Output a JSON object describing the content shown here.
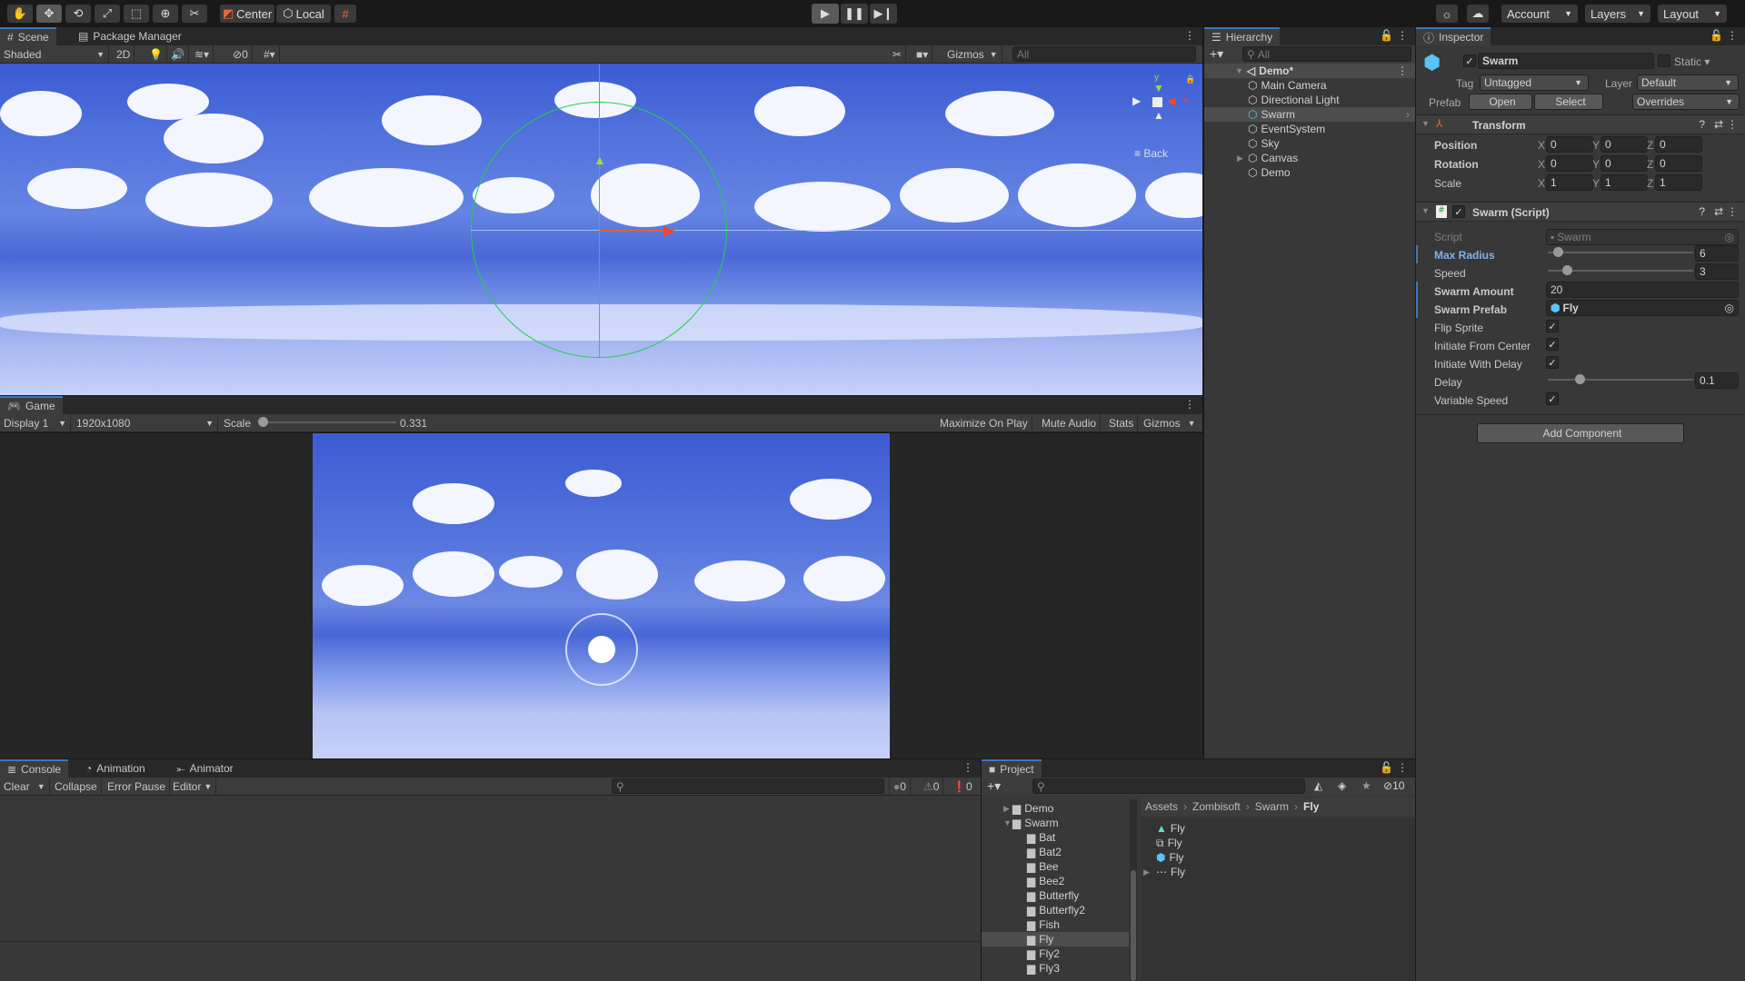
{
  "toolbar": {
    "tools": [
      "hand-tool",
      "move-tool",
      "rotate-tool",
      "scale-tool",
      "rect-tool",
      "transform-tool",
      "custom-tool"
    ],
    "pivot_mode": "Center",
    "pivot_rotation": "Local",
    "account": "Account",
    "layers": "Layers",
    "layout": "Layout"
  },
  "scene": {
    "tabs": [
      {
        "label": "Scene"
      },
      {
        "label": "Package Manager"
      }
    ],
    "shading": "Shaded",
    "mode_2d": "2D",
    "hidden_count": "0",
    "gizmos": "Gizmos",
    "search_placeholder": "All",
    "back_label": "Back",
    "axis_x": "x",
    "axis_y": "y"
  },
  "game": {
    "tab": "Game",
    "display": "Display 1",
    "resolution": "1920x1080",
    "scale_label": "Scale",
    "scale_value": "0.331",
    "scale_fraction": 0.02,
    "maximize": "Maximize On Play",
    "mute": "Mute Audio",
    "stats": "Stats",
    "gizmos": "Gizmos"
  },
  "console": {
    "tabs": [
      {
        "label": "Console"
      },
      {
        "label": "Animation"
      },
      {
        "label": "Animator"
      }
    ],
    "clear": "Clear",
    "collapse": "Collapse",
    "error_pause": "Error Pause",
    "editor": "Editor",
    "log_count": "0",
    "warn_count": "0",
    "error_count": "0"
  },
  "hierarchy": {
    "title": "Hierarchy",
    "search_placeholder": "All",
    "scene": "Demo*",
    "items": [
      {
        "label": "Main Camera"
      },
      {
        "label": "Directional Light"
      },
      {
        "label": "Swarm",
        "selected": true
      },
      {
        "label": "EventSystem"
      },
      {
        "label": "Sky"
      },
      {
        "label": "Canvas",
        "expandable": true
      },
      {
        "label": "Demo"
      }
    ]
  },
  "inspector": {
    "title": "Inspector",
    "object_name": "Swarm",
    "static_label": "Static",
    "tag_label": "Tag",
    "tag": "Untagged",
    "layer_label": "Layer",
    "layer": "Default",
    "prefab_label": "Prefab",
    "open": "Open",
    "select": "Select",
    "overrides": "Overrides",
    "transform": {
      "title": "Transform",
      "rows": [
        {
          "label": "Position",
          "x": "0",
          "y": "0",
          "z": "0"
        },
        {
          "label": "Rotation",
          "x": "0",
          "y": "0",
          "z": "0"
        },
        {
          "label": "Scale",
          "x": "1",
          "y": "1",
          "z": "1"
        }
      ]
    },
    "script": {
      "title": "Swarm (Script)",
      "script_label": "Script",
      "script_value": "Swarm",
      "max_radius_label": "Max Radius",
      "max_radius": "6",
      "max_radius_fraction": 0.07,
      "speed_label": "Speed",
      "speed": "3",
      "speed_fraction": 0.13,
      "swarm_amount_label": "Swarm Amount",
      "swarm_amount": "20",
      "swarm_prefab_label": "Swarm Prefab",
      "swarm_prefab": "Fly",
      "flip_sprite_label": "Flip Sprite",
      "initiate_center_label": "Initiate From Center",
      "initiate_delay_label": "Initiate With Delay",
      "delay_label": "Delay",
      "delay": "0.1",
      "delay_fraction": 0.22,
      "variable_speed_label": "Variable Speed"
    },
    "add_component": "Add Component"
  },
  "project": {
    "title": "Project",
    "hidden_count": "10",
    "tree": [
      {
        "label": "Demo",
        "indent": 1,
        "arrow": "right"
      },
      {
        "label": "Swarm",
        "indent": 1,
        "arrow": "down"
      },
      {
        "label": "Bat",
        "indent": 2
      },
      {
        "label": "Bat2",
        "indent": 2
      },
      {
        "label": "Bee",
        "indent": 2
      },
      {
        "label": "Bee2",
        "indent": 2
      },
      {
        "label": "Butterfly",
        "indent": 2
      },
      {
        "label": "Butterfly2",
        "indent": 2
      },
      {
        "label": "Fish",
        "indent": 2
      },
      {
        "label": "Fly",
        "indent": 2,
        "selected": true
      },
      {
        "label": "Fly2",
        "indent": 2
      },
      {
        "label": "Fly3",
        "indent": 2
      }
    ],
    "breadcrumb": [
      "Assets",
      "Zombisoft",
      "Swarm",
      "Fly"
    ],
    "assets": [
      {
        "label": "Fly",
        "icon": "animation-clip-icon"
      },
      {
        "label": "Fly",
        "icon": "animator-controller-icon"
      },
      {
        "label": "Fly",
        "icon": "prefab-icon"
      },
      {
        "label": "Fly",
        "icon": "sprite-sheet-icon"
      }
    ]
  },
  "colors": {
    "accent": "#3a79bb",
    "sky_top": "#3a5bd0",
    "sky_light": "#c9d2fb",
    "gizmo_circle": "#22d04a"
  }
}
